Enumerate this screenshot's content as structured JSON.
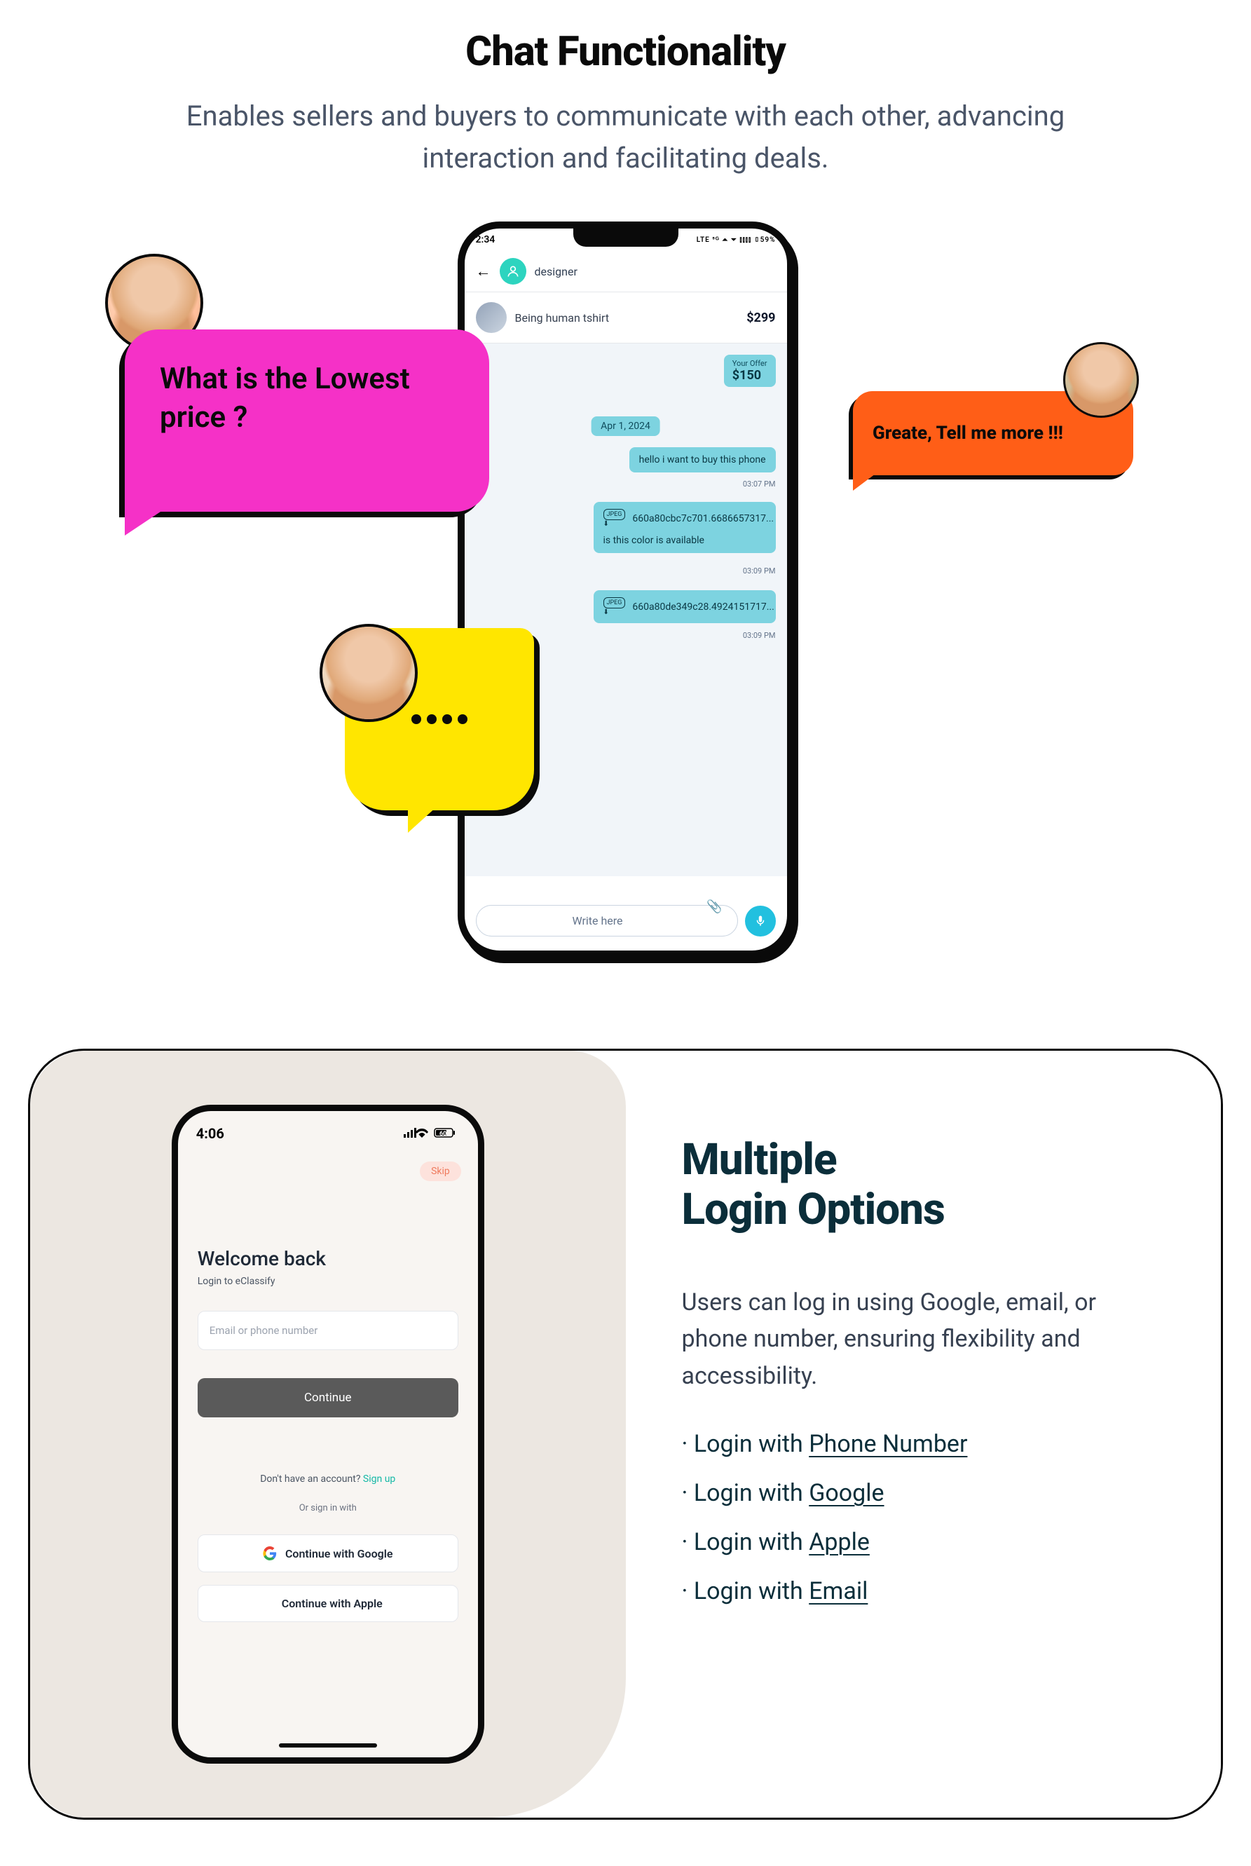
{
  "section1": {
    "title": "Chat Functionality",
    "description": "Enables sellers and buyers to communicate with each other, advancing interaction and facilitating deals.",
    "phone": {
      "time": "2:34",
      "status_right": "LTE ⁵ᴳ ⏶ ⏷ ⫾⫾⫾⫾ ▯59%",
      "chat_user": "designer",
      "product_name": "Being human tshirt",
      "product_price": "$299",
      "offer_label": "Your Offer",
      "offer_amount": "$150",
      "date_chip": "Apr 1, 2024",
      "msg1": "hello i want to buy this phone",
      "time1": "03:07 PM",
      "jpeg1": "660a80cbc7c701.6686657317...",
      "msg2": "is this color is available",
      "time2": "03:09 PM",
      "jpeg2": "660a80de349c28.4924151717...",
      "time3": "03:09 PM",
      "jpeg_label": "JPEG",
      "input_placeholder": "Write here"
    },
    "bubble_pink": "What is the Lowest price ?",
    "bubble_orange": "Greate, Tell me more !!!"
  },
  "section2": {
    "phone": {
      "time": "4:06",
      "battery": "60",
      "skip": "Skip",
      "welcome": "Welcome back",
      "sub": "Login to eClassify",
      "input_placeholder": "Email or phone number",
      "continue": "Continue",
      "signup_pre": "Don't have an account?  ",
      "signup": "Sign up",
      "divider": "Or sign in with",
      "google_btn": "Continue with Google",
      "apple_btn": "Continue with Apple"
    },
    "title_line1": "Multiple",
    "title_line2": "Login Options",
    "description": "Users can log in using Google, email, or phone number, ensuring flexibility and accessibility.",
    "list": [
      {
        "pre": "Login with ",
        "em": "Phone Number"
      },
      {
        "pre": "Login with ",
        "em": "Google"
      },
      {
        "pre": "Login with ",
        "em": "Apple"
      },
      {
        "pre": "Login with ",
        "em": "Email"
      }
    ]
  }
}
